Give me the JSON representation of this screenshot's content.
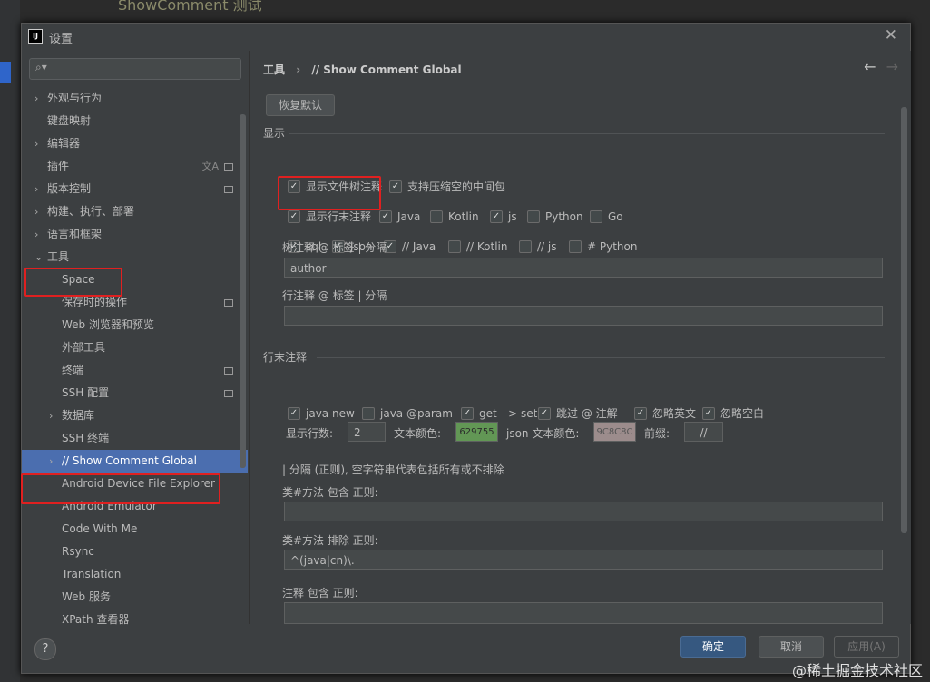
{
  "background": {
    "code": "ShowComment 测试"
  },
  "window": {
    "title": "设置",
    "logo": "IJ"
  },
  "sidebar": {
    "search_placeholder": "",
    "items": [
      {
        "label": "外观与行为",
        "arrow": "›",
        "level": 0
      },
      {
        "label": "键盘映射",
        "arrow": "",
        "level": 0
      },
      {
        "label": "编辑器",
        "arrow": "›",
        "level": 0
      },
      {
        "label": "插件",
        "arrow": "",
        "level": 0
      },
      {
        "label": "版本控制",
        "arrow": "›",
        "level": 0
      },
      {
        "label": "构建、执行、部署",
        "arrow": "›",
        "level": 0
      },
      {
        "label": "语言和框架",
        "arrow": "›",
        "level": 0
      },
      {
        "label": "工具",
        "arrow": "⌄",
        "level": 0
      },
      {
        "label": "Space",
        "arrow": "",
        "level": 1
      },
      {
        "label": "保存时的操作",
        "arrow": "",
        "level": 1
      },
      {
        "label": "Web 浏览器和预览",
        "arrow": "",
        "level": 1
      },
      {
        "label": "外部工具",
        "arrow": "",
        "level": 1
      },
      {
        "label": "终端",
        "arrow": "",
        "level": 1
      },
      {
        "label": "SSH 配置",
        "arrow": "",
        "level": 1
      },
      {
        "label": "数据库",
        "arrow": "›",
        "level": 1
      },
      {
        "label": "SSH 终端",
        "arrow": "",
        "level": 1
      },
      {
        "label": "// Show Comment Global",
        "arrow": "›",
        "level": 1
      },
      {
        "label": "Android Device File Explorer",
        "arrow": "",
        "level": 1
      },
      {
        "label": "Android Emulator",
        "arrow": "",
        "level": 1
      },
      {
        "label": "Code With Me",
        "arrow": "",
        "level": 1
      },
      {
        "label": "Rsync",
        "arrow": "",
        "level": 1
      },
      {
        "label": "Translation",
        "arrow": "",
        "level": 1
      },
      {
        "label": "Web 服务",
        "arrow": "",
        "level": 1
      },
      {
        "label": "XPath 查看器",
        "arrow": "",
        "level": 1
      }
    ]
  },
  "main": {
    "breadcrumb_parent": "工具",
    "breadcrumb_sep": "›",
    "breadcrumb_current": "// Show Comment Global",
    "back_icon": "←",
    "forward_icon": "→",
    "restore_label": "恢复默认",
    "display_section": "显示",
    "row1": [
      {
        "label": "显示文件树注释",
        "checked": true
      },
      {
        "label": "支持压缩空的中间包",
        "checked": true
      }
    ],
    "row2": [
      {
        "label": "显示行末注释",
        "checked": true
      },
      {
        "label": "Java",
        "checked": true
      },
      {
        "label": "Kotlin",
        "checked": false
      },
      {
        "label": "js",
        "checked": true
      },
      {
        "label": "Python",
        "checked": false
      },
      {
        "label": "Go",
        "checked": false
      }
    ],
    "row3": [
      {
        "label": "sql",
        "checked": true
      },
      {
        "label": "json",
        "checked": true
      },
      {
        "label": "// Java",
        "checked": true
      },
      {
        "label": "// Kotlin",
        "checked": false
      },
      {
        "label": "// js",
        "checked": false
      },
      {
        "label": "# Python",
        "checked": false
      }
    ],
    "tree_comment_label": "树注释 @ 标签 | 分隔",
    "tree_comment_value": "author",
    "line_comment_label": "行注释 @ 标签 | 分隔",
    "line_comment_value": "",
    "line_end_section": "行末注释",
    "row4": [
      {
        "label": "java new",
        "checked": true
      },
      {
        "label": "java @param",
        "checked": false
      },
      {
        "label": "get --> set",
        "checked": true
      },
      {
        "label": "跳过 @ 注解",
        "checked": true
      },
      {
        "label": "忽略英文",
        "checked": true
      },
      {
        "label": "忽略空白",
        "checked": true
      }
    ],
    "show_lines_label": "显示行数:",
    "show_lines_value": "2",
    "text_color_label": "文本颜色:",
    "text_color_value": "629755",
    "text_color_hex": "#629755",
    "json_color_label": "json 文本颜色:",
    "json_color_value": "9C8C8C",
    "json_color_hex": "#9c8c8c",
    "prefix_label": "前缀:",
    "prefix_value": "//",
    "regex_note": "| 分隔 (正则), 空字符串代表包括所有或不排除",
    "class_include_label": "类#方法 包含 正则:",
    "class_include_value": "",
    "class_exclude_label": "类#方法 排除 正则:",
    "class_exclude_value": "^(java|cn)\\.",
    "comment_include_label": "注释 包含 正则:",
    "comment_include_value": ""
  },
  "footer": {
    "help_label": "?",
    "ok_label": "确定",
    "cancel_label": "取消",
    "apply_label": "应用(A)"
  },
  "watermark": "@稀土掘金技术社区",
  "colors": {
    "accent": "#4b6eaf",
    "highlight": "#e02020",
    "ok_button": "#365880"
  }
}
